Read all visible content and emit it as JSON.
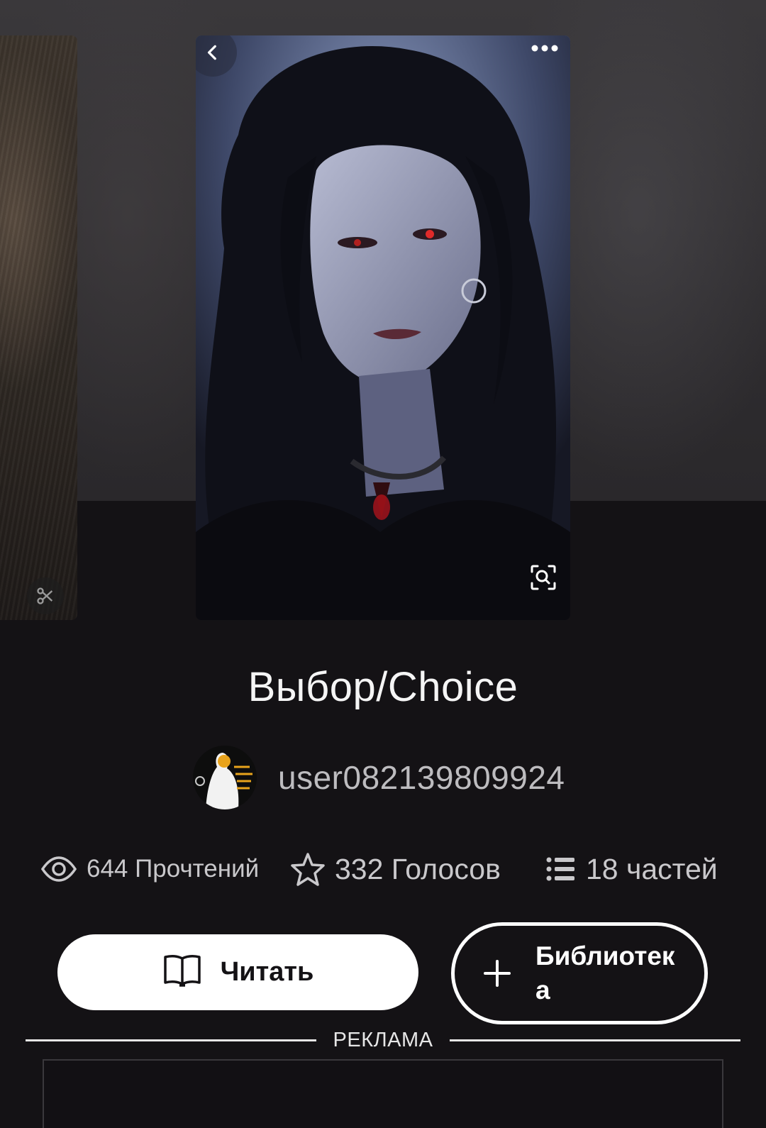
{
  "story": {
    "title": "Выбор/Choice",
    "author": "user082139809924"
  },
  "stats": {
    "reads": "644 Прочтений",
    "votes": "332 Голосов",
    "parts": "18 частей"
  },
  "actions": {
    "read_label": "Читать",
    "library_label": "Библиотека"
  },
  "ad": {
    "label": "РЕКЛАМА"
  },
  "icons": {
    "cover_back": "chevron-left-icon",
    "cover_more": "more-dots-icon",
    "cover_zoom": "zoom-search-icon",
    "left_cover_action": "scissors-icon",
    "reads": "eye-icon",
    "votes": "star-icon",
    "parts": "list-icon",
    "read": "open-book-icon",
    "library": "plus-icon"
  },
  "colors": {
    "background": "#141215",
    "primary_button": "#ffffff",
    "text_muted": "#c9c8cb"
  }
}
